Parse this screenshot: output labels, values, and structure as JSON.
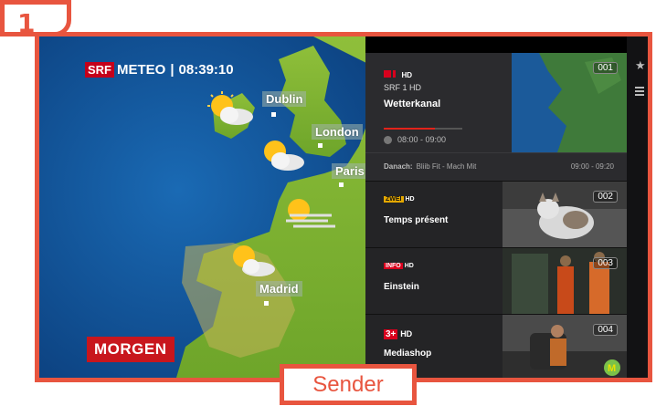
{
  "step": "1",
  "tag": "Sender",
  "weather": {
    "brand": "SRF",
    "meteo": "METEO",
    "separator": "|",
    "clock": "08:39:10",
    "cities": [
      "Dublin",
      "London",
      "Paris",
      "Madrid"
    ],
    "period": "MORGEN"
  },
  "guide": {
    "active": {
      "logo_hd": "HD",
      "channel": "SRF 1 HD",
      "program": "Wetterkanal",
      "number": "001",
      "time": "08:00 - 09:00",
      "progress": 0.65
    },
    "next": {
      "label": "Danach:",
      "program": "Bliib Fit - Mach Mit",
      "time": "09:00 - 09:20"
    },
    "channels": [
      {
        "logo": "ZWEI",
        "logo_hd": "HD",
        "title": "Temps présent",
        "number": "002",
        "logo_color": "#e5a800"
      },
      {
        "logo": "INFO",
        "logo_hd": "HD",
        "title": "Einstein",
        "number": "003",
        "logo_color": "#d9001d"
      },
      {
        "logo": "3+",
        "logo_hd": "HD",
        "title": "Mediashop",
        "number": "004",
        "logo_color": "#d9001d"
      }
    ]
  },
  "sidebar": {
    "icons": [
      "star-icon",
      "list-icon"
    ]
  },
  "colors": {
    "accent": "#e8553f",
    "srf_red": "#c8161d",
    "panel": "#1d1d1f"
  }
}
